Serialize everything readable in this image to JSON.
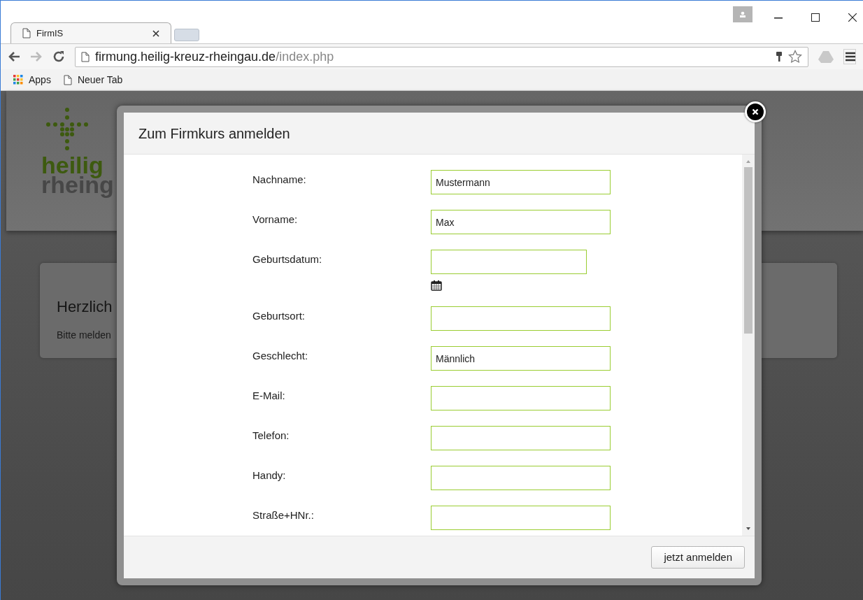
{
  "browser": {
    "tabs": [
      {
        "title": "FirmIS",
        "selected": true
      }
    ],
    "url_host": "firmung.heilig-kreuz-rheingau.de",
    "url_path": "/index.php",
    "bookmarks": [
      {
        "label": "Apps",
        "kind": "apps"
      },
      {
        "label": "Neuer Tab",
        "kind": "page"
      }
    ]
  },
  "page": {
    "logo_lines": [
      "heilig",
      "rheing"
    ],
    "card": {
      "heading": "Herzlich",
      "text": "Bitte melden"
    }
  },
  "dialog": {
    "title": "Zum Firmkurs anmelden",
    "fields": [
      {
        "label": "Nachname:",
        "value": "Mustermann",
        "kind": "text"
      },
      {
        "label": "Vorname:",
        "value": "Max",
        "kind": "text"
      },
      {
        "label": "Geburtsdatum:",
        "kind": "date"
      },
      {
        "label": "Geburtsort:",
        "kind": "text"
      },
      {
        "label": "Geschlecht:",
        "value": "Männlich",
        "kind": "text"
      },
      {
        "label": "E-Mail:",
        "kind": "text"
      },
      {
        "label": "Telefon:",
        "kind": "text"
      },
      {
        "label": "Handy:",
        "kind": "text"
      },
      {
        "label": "Straße+HNr.:",
        "kind": "text"
      }
    ],
    "submit": "jetzt anmelden"
  }
}
